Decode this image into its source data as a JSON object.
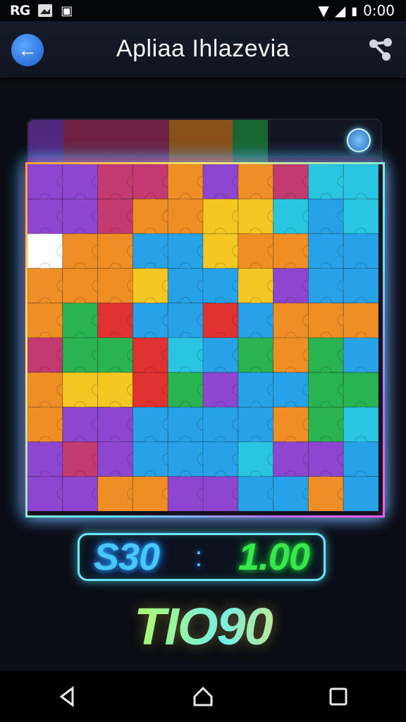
{
  "status_bar": {
    "left_icons": [
      "notification-icon",
      "image-icon",
      "app-icon"
    ],
    "left_label": "RG",
    "time": "0:00"
  },
  "app_bar": {
    "title": "Apliaa Ihlazevia",
    "back_icon": "arrow-left-icon",
    "share_icon": "share-icon"
  },
  "score": {
    "left": "S30",
    "separator": ":",
    "right": "1.00"
  },
  "footer_text": "TIO90",
  "colors": {
    "score_left": "#48c8ff",
    "score_right": "#37e84d",
    "accent_back": "#2f7fe0",
    "puzzle_palette": [
      "#8a3fd0",
      "#f08a1e",
      "#1f9fe8",
      "#22b04a",
      "#e02a2a",
      "#f5c51a",
      "#22c3e0",
      "#c0326a",
      "#ffffff"
    ]
  },
  "nav": {
    "back_icon": "nav-back-icon",
    "home_icon": "nav-home-icon",
    "recents_icon": "nav-recents-icon"
  }
}
